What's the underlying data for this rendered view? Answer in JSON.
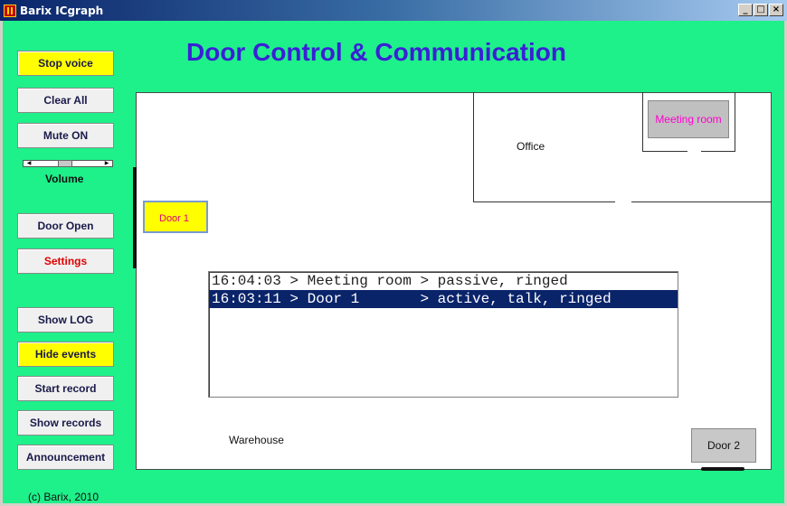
{
  "window": {
    "title": "Barix ICgraph",
    "controls": {
      "minimize": "_",
      "maximize": "□",
      "close": "×"
    }
  },
  "heading": "Door Control & Communication",
  "sidebar": {
    "stop_voice": "Stop voice",
    "clear_all": "Clear All",
    "mute": "Mute ON",
    "volume_label": "Volume",
    "volume_level": 0.45,
    "door_open": "Door Open",
    "settings": "Settings",
    "show_log": "Show LOG",
    "hide_events": "Hide events",
    "start_record": "Start record",
    "show_records": "Show records",
    "announcement": "Announcement"
  },
  "map": {
    "office_label": "Office",
    "warehouse_label": "Warehouse",
    "devices": {
      "door1": "Door 1",
      "meeting_room": "Meeting room",
      "door2": "Door 2"
    }
  },
  "log": [
    {
      "text": "16:04:03 > Meeting room > passive, ringed",
      "selected": false
    },
    {
      "text": "16:03:11 > Door 1       > active, talk, ringed",
      "selected": true
    }
  ],
  "footer": "(c) Barix, 2010",
  "colors": {
    "background": "#1ef08a",
    "heading": "#3b1fd6",
    "highlight_button": "#ffff00",
    "device_label": "#ff00d0",
    "selection": "#0a246a"
  }
}
